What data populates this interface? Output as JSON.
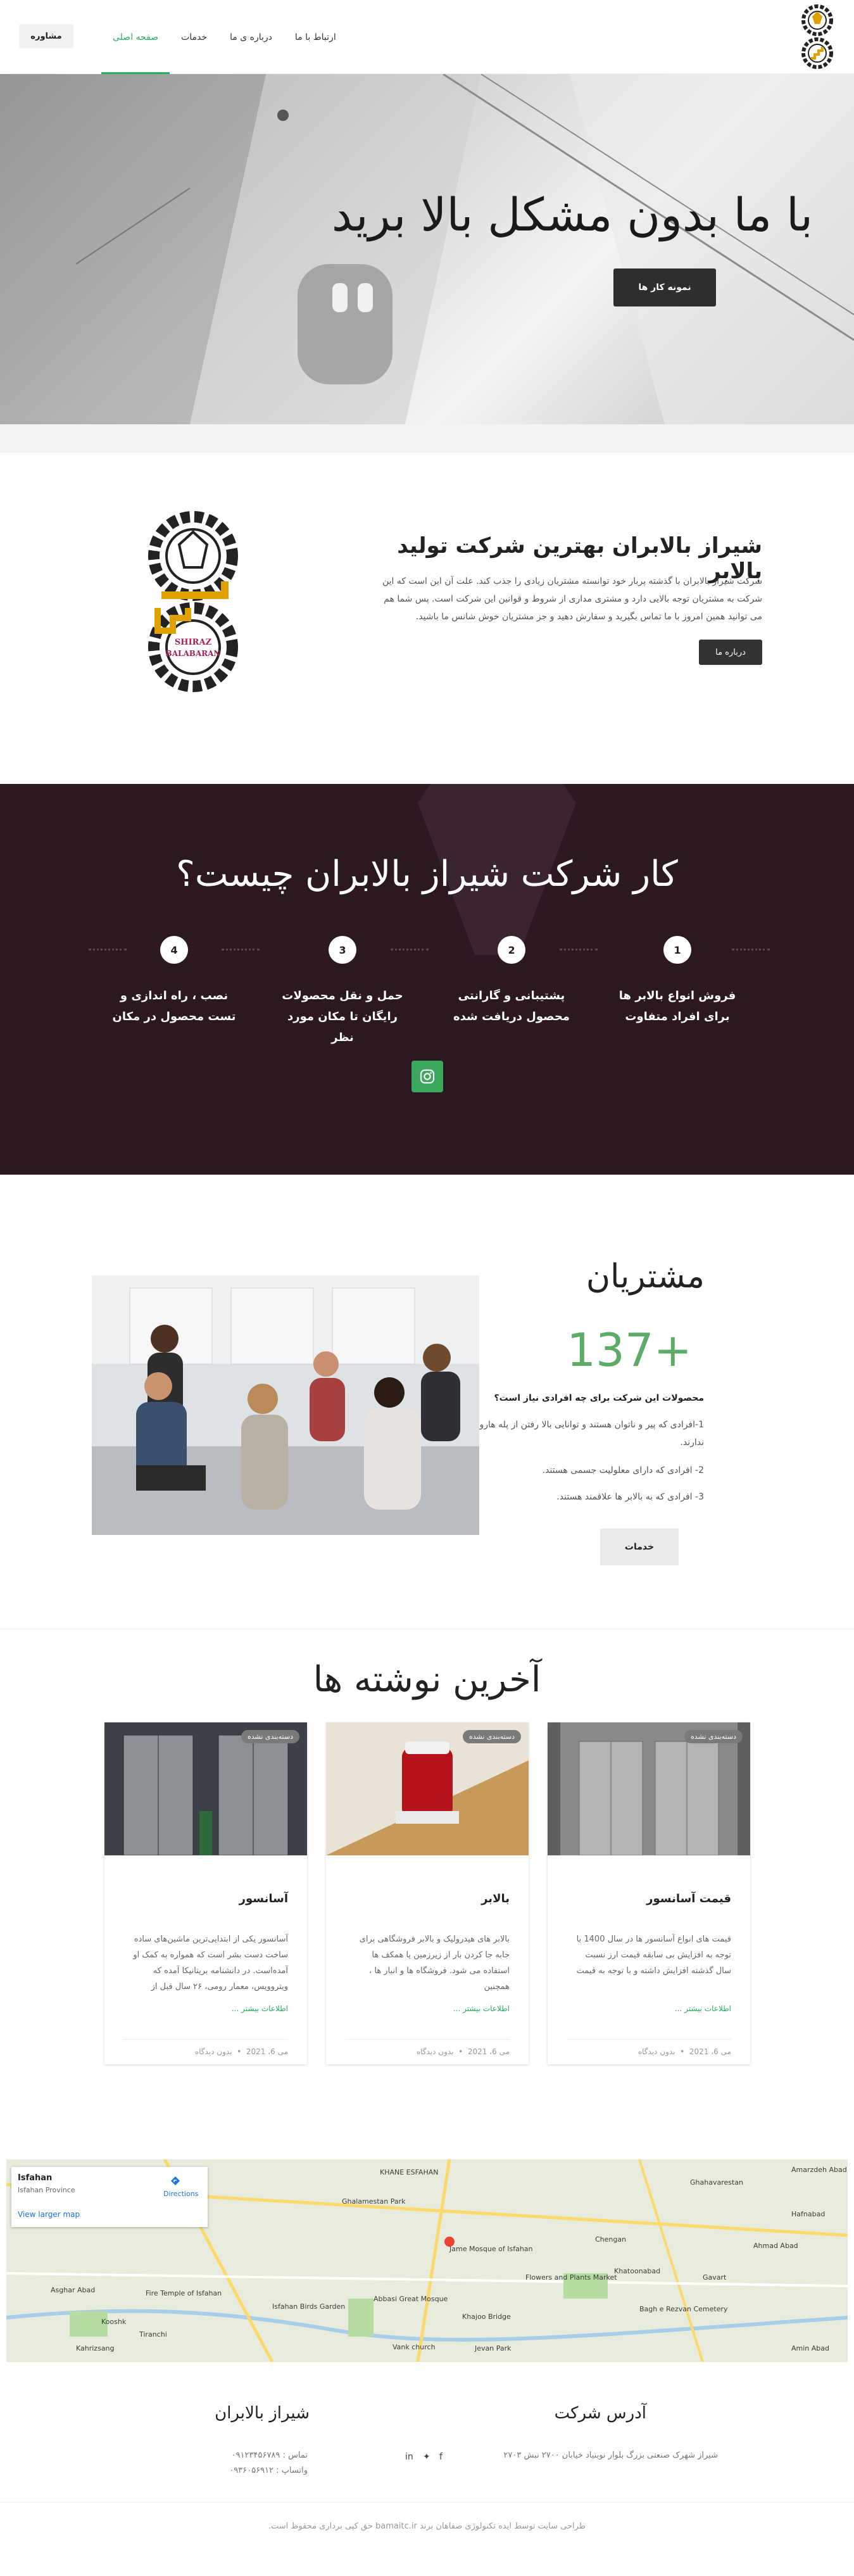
{
  "header": {
    "nav": [
      "صفحه اصلی",
      "خدمات",
      "درباره ی ما",
      "ارتباط با ما"
    ],
    "consult_label": "مشاوره",
    "logo_alt": "SHIRAZ BALABARAN"
  },
  "hero": {
    "title": "با ما بدون مشکل بالا برید",
    "button": "نمونه کار ها"
  },
  "about": {
    "title": "شیراز بالابران بهترین شرکت تولید بالابر",
    "text": "شرکت شیراز بالابران با گذشته پربار خود توانسته مشتریان زیادی را جذب کند. علت آن این است که این شرکت به مشتریان توجه بالایی دارد و مشتری مداری از شروط و قوانین این شرکت است. پس شما هم می توانید همین امروز با ما تماس بگیرید و سفارش دهید و جز مشتریان خوش شانس ما باشید.",
    "button": "درباره ما",
    "logo_text": [
      "SHIRAZ",
      "BALABARAN"
    ]
  },
  "what": {
    "title": "کار شرکت شیراز بالابران چیست؟",
    "steps": [
      {
        "num": "1",
        "text": "فروش انواع بالابر ها برای افراد متفاوت"
      },
      {
        "num": "2",
        "text": "پشتیبانی و گارانتی محصول دریافت شده"
      },
      {
        "num": "3",
        "text": "حمل و نقل محصولات رایگان تا مکان مورد نظر"
      },
      {
        "num": "4",
        "text": "نصب ، راه اندازی و تست محصول در مکان"
      }
    ]
  },
  "customers": {
    "title": "مشتریان",
    "count": "+137",
    "question": "محصولات این شرکت برای چه افرادی نیاز است؟",
    "items": [
      "1-افرادی که پیر و ناتوان هستند و توانایی بالا رفتن از پله هارو ندارند.",
      "2- افرادی که دارای معلولیت جسمی هستند.",
      "3- افرادی که به بالابر ها علاقمند هستند."
    ],
    "button": "خدمات"
  },
  "blog": {
    "title": "آخرین نوشته ها",
    "posts": [
      {
        "category": "دسته‌بندی نشده",
        "title": "قیمت آسانسور",
        "excerpt": "قیمت های انواع آسانسور ها در سال 1400 با توجه به افزایش بی سابقه قیمت ارز نسبت سال گذشته افزایش داشته و با توجه به قیمت",
        "more": "اطلاعات بیشتر ...",
        "date": "می 6، 2021",
        "comments": "بدون دیدگاه"
      },
      {
        "category": "دسته‌بندی نشده",
        "title": "بالابر",
        "excerpt": "بالابر های هیدرولیک و بالابر فروشگاهی برای جابه جا کردن بار از زیرزمین یا همکف ها استفاده می شود. فروشگاه ها و انبار ها ، همچنین",
        "more": "اطلاعات بیشتر ...",
        "date": "می 6، 2021",
        "comments": "بدون دیدگاه"
      },
      {
        "category": "دسته‌بندی نشده",
        "title": "آسانسور",
        "excerpt": "آسانسور یکی از ابتدایی‌ترین ماشین‌های ساده ساخت دست بشر است که همواره به کمک او آمده‌است. در دانشنامه بریتانیکا آمده که ویتروویس، معمار رومی، ۲۶ سال قبل از",
        "more": "اطلاعات بیشتر ...",
        "date": "می 6، 2021",
        "comments": "بدون دیدگاه"
      }
    ]
  },
  "map": {
    "title": "Isfahan",
    "subtitle": "Isfahan Province",
    "directions": "Directions",
    "larger": "View larger map",
    "labels": [
      "KHANE ESFAHAN",
      "Ghahavarestan",
      "Amarzdeh Abad",
      "Ghalamestan Park",
      "Jame Mosque of Isfahan",
      "Fire Temple of Isfahan",
      "Isfahan Birds Garden",
      "Abbasi Great Mosque",
      "Vank church",
      "Khajoo Bridge",
      "Flowers and Plants Market",
      "Khatoonabad",
      "Bagh e Rezvan Cemetery",
      "Asghar Abad",
      "Kooshk",
      "Tiranchi",
      "Kahrizsang",
      "Jevan Park",
      "Amin Abad",
      "Chengan",
      "Gavart",
      "Hafnabad",
      "Ahmad Abad"
    ]
  },
  "footer": {
    "address_title": "آدرس شرکت",
    "address": "شیراز شهرک صنعتی بزرگ بلوار نوبنیاد خیابان ۲۷۰۰ نبش ۲۷۰۳",
    "company_title": "شیراز بالابران",
    "contact": "تماس : ۰۹۱۲۳۴۵۶۷۸۹",
    "whatsapp": "واتساپ : ۰۹۳۶۰۵۶۹۱۲",
    "copyright": "طراحی سایت توسط ایده تکنولوژی صفاهان برند bamaitc.ir حق کپی برداری محفوظ است."
  },
  "colors": {
    "accent": "#27ae60",
    "dark": "#2b1820",
    "green_count": "#5cab69"
  }
}
